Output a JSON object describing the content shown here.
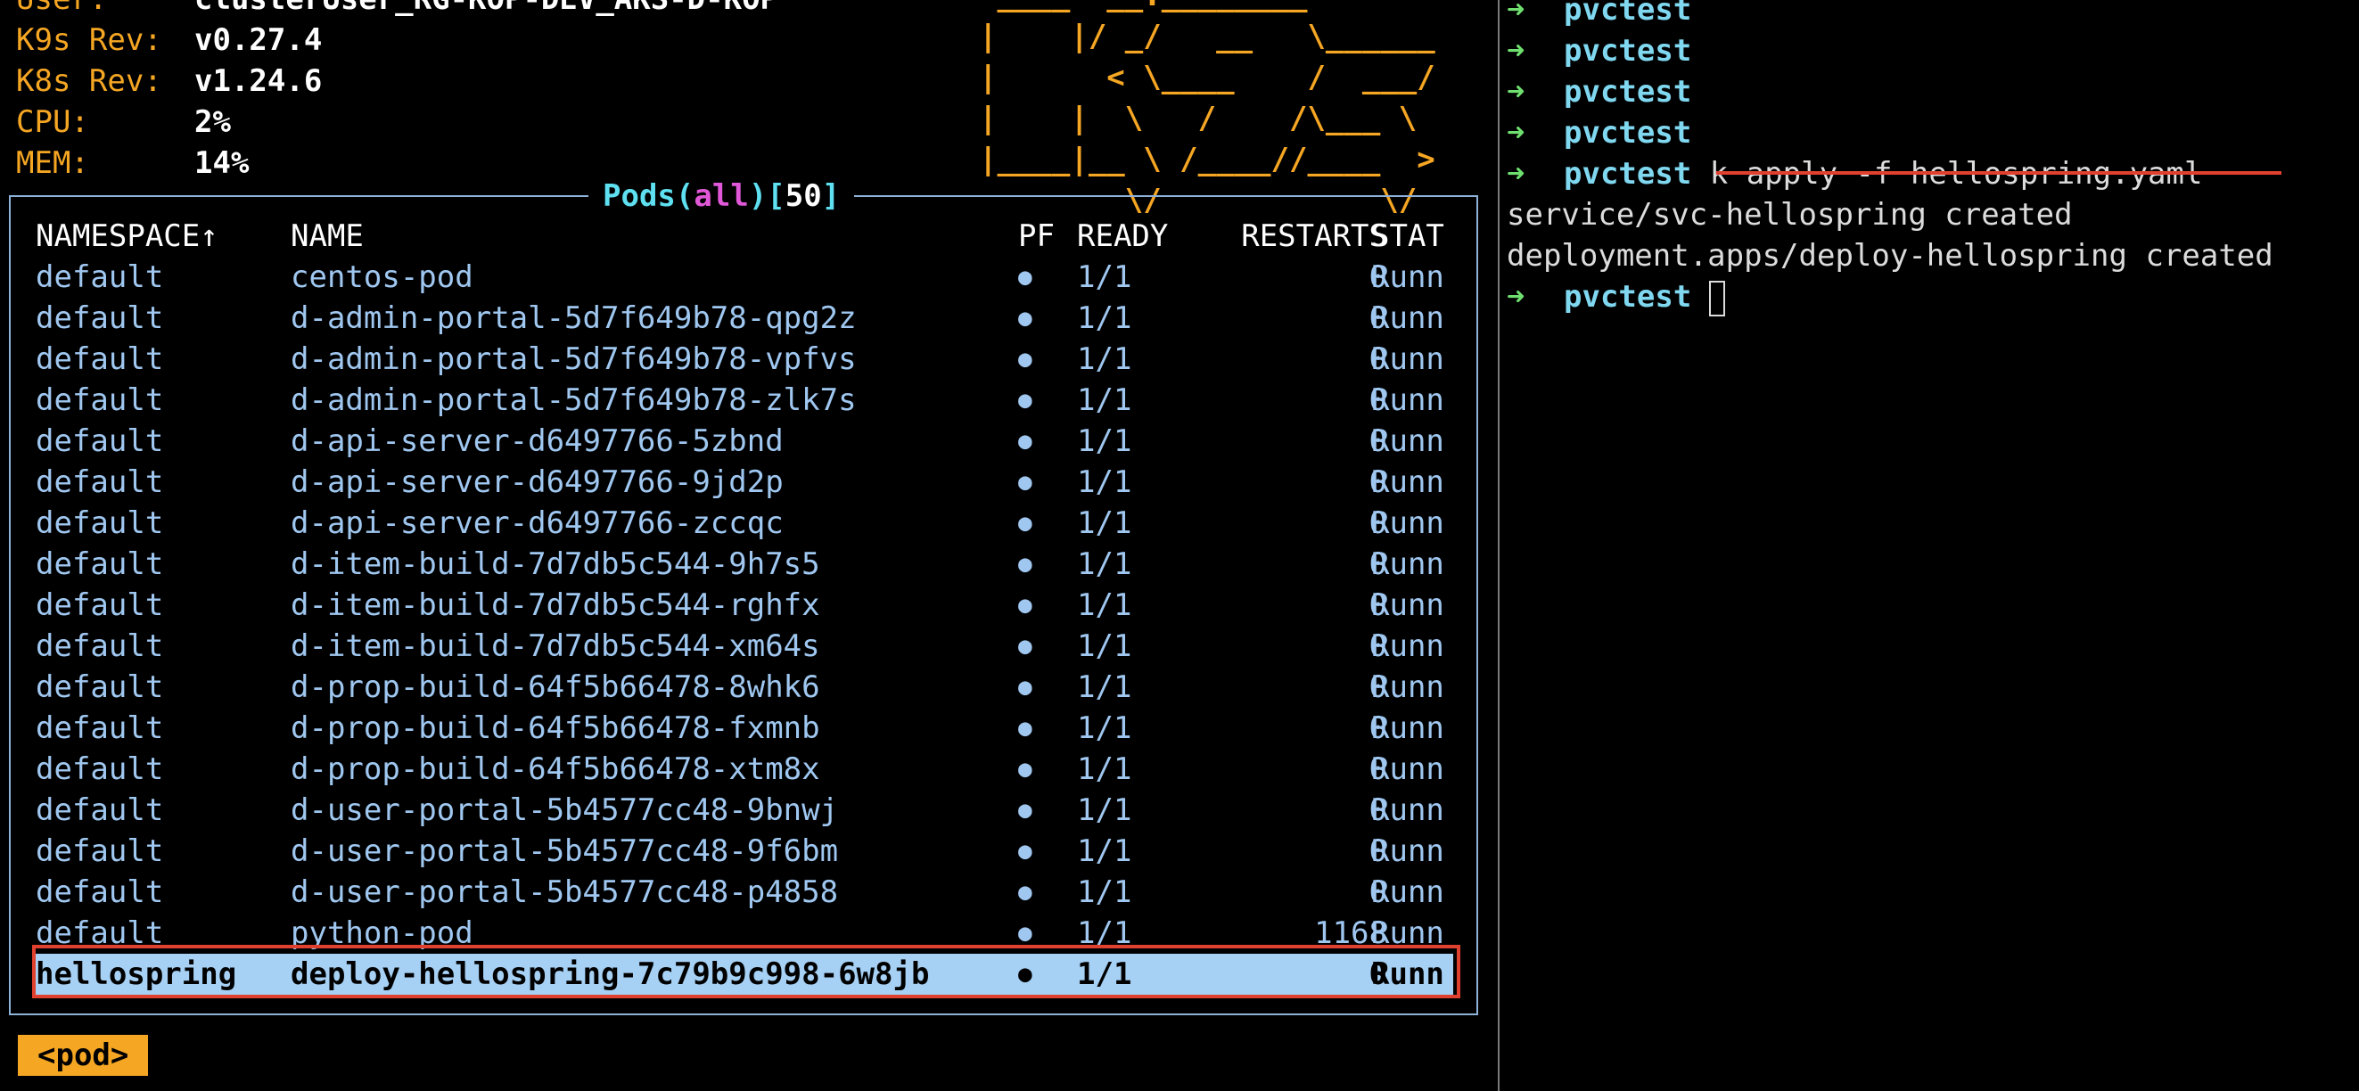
{
  "info": [
    {
      "key": "User:",
      "value": "clusterUser_RG-KOP-DEV_AKS-D-KOP",
      "partial": true
    },
    {
      "key": "K9s Rev:",
      "value": "v0.27.4"
    },
    {
      "key": "K8s Rev:",
      "value": "v1.24.6"
    },
    {
      "key": "CPU:",
      "value": "2%"
    },
    {
      "key": "MEM:",
      "value": "14%"
    }
  ],
  "logo_lines": [
    " ____  __.________       ",
    "|    |/ _/   __   \\______",
    "|      < \\____    /  ___/",
    "|    |  \\   /    /\\___ \\ ",
    "|____|__ \\ /____//____  >",
    "        \\/            \\/ "
  ],
  "pods_view": {
    "resource": "Pods",
    "scope": "all",
    "count": "50"
  },
  "table": {
    "headers": {
      "namespace": "NAMESPACE↑",
      "name": "NAME",
      "pf": "PF",
      "ready": "READY",
      "restarts": "RESTARTS",
      "status": "STAT"
    },
    "rows": [
      {
        "namespace": "default",
        "name": "centos-pod",
        "pf": "●",
        "ready": "1/1",
        "restarts": "0",
        "status": "Runn"
      },
      {
        "namespace": "default",
        "name": "d-admin-portal-5d7f649b78-qpg2z",
        "pf": "●",
        "ready": "1/1",
        "restarts": "0",
        "status": "Runn"
      },
      {
        "namespace": "default",
        "name": "d-admin-portal-5d7f649b78-vpfvs",
        "pf": "●",
        "ready": "1/1",
        "restarts": "0",
        "status": "Runn"
      },
      {
        "namespace": "default",
        "name": "d-admin-portal-5d7f649b78-zlk7s",
        "pf": "●",
        "ready": "1/1",
        "restarts": "0",
        "status": "Runn"
      },
      {
        "namespace": "default",
        "name": "d-api-server-d6497766-5zbnd",
        "pf": "●",
        "ready": "1/1",
        "restarts": "0",
        "status": "Runn"
      },
      {
        "namespace": "default",
        "name": "d-api-server-d6497766-9jd2p",
        "pf": "●",
        "ready": "1/1",
        "restarts": "0",
        "status": "Runn"
      },
      {
        "namespace": "default",
        "name": "d-api-server-d6497766-zccqc",
        "pf": "●",
        "ready": "1/1",
        "restarts": "0",
        "status": "Runn"
      },
      {
        "namespace": "default",
        "name": "d-item-build-7d7db5c544-9h7s5",
        "pf": "●",
        "ready": "1/1",
        "restarts": "0",
        "status": "Runn"
      },
      {
        "namespace": "default",
        "name": "d-item-build-7d7db5c544-rghfx",
        "pf": "●",
        "ready": "1/1",
        "restarts": "0",
        "status": "Runn"
      },
      {
        "namespace": "default",
        "name": "d-item-build-7d7db5c544-xm64s",
        "pf": "●",
        "ready": "1/1",
        "restarts": "0",
        "status": "Runn"
      },
      {
        "namespace": "default",
        "name": "d-prop-build-64f5b66478-8whk6",
        "pf": "●",
        "ready": "1/1",
        "restarts": "0",
        "status": "Runn"
      },
      {
        "namespace": "default",
        "name": "d-prop-build-64f5b66478-fxmnb",
        "pf": "●",
        "ready": "1/1",
        "restarts": "0",
        "status": "Runn"
      },
      {
        "namespace": "default",
        "name": "d-prop-build-64f5b66478-xtm8x",
        "pf": "●",
        "ready": "1/1",
        "restarts": "0",
        "status": "Runn"
      },
      {
        "namespace": "default",
        "name": "d-user-portal-5b4577cc48-9bnwj",
        "pf": "●",
        "ready": "1/1",
        "restarts": "0",
        "status": "Runn"
      },
      {
        "namespace": "default",
        "name": "d-user-portal-5b4577cc48-9f6bm",
        "pf": "●",
        "ready": "1/1",
        "restarts": "0",
        "status": "Runn"
      },
      {
        "namespace": "default",
        "name": "d-user-portal-5b4577cc48-p4858",
        "pf": "●",
        "ready": "1/1",
        "restarts": "0",
        "status": "Runn"
      },
      {
        "namespace": "default",
        "name": "python-pod",
        "pf": "●",
        "ready": "1/1",
        "restarts": "1168",
        "status": "Runn"
      },
      {
        "namespace": "hellospring",
        "name": "deploy-hellospring-7c79b9c998-6w8jb",
        "pf": "●",
        "ready": "1/1",
        "restarts": "0",
        "status": "Runn",
        "selected": true
      }
    ]
  },
  "crumb": "<pod>",
  "terminal": {
    "arrow": "➜",
    "lines": [
      {
        "kind": "prompt",
        "dir": "pvctest",
        "cmd": ""
      },
      {
        "kind": "prompt",
        "dir": "pvctest",
        "cmd": ""
      },
      {
        "kind": "prompt",
        "dir": "pvctest",
        "cmd": ""
      },
      {
        "kind": "prompt",
        "dir": "pvctest",
        "cmd": ""
      },
      {
        "kind": "prompt",
        "dir": "pvctest",
        "cmd": "k apply -f hellospring.yaml"
      },
      {
        "kind": "output",
        "text": "service/svc-hellospring created"
      },
      {
        "kind": "output",
        "text": "deployment.apps/deploy-hellospring created"
      },
      {
        "kind": "prompt",
        "dir": "pvctest",
        "cmd": "",
        "cursor": true
      }
    ]
  },
  "colors": {
    "label": "#f5a623",
    "text": "#9fc7f0",
    "selection": "#a6d0f4",
    "highlight": "#e0412e",
    "prompt_arrow": "#6fe06f",
    "prompt_dir": "#7fd8f0"
  }
}
